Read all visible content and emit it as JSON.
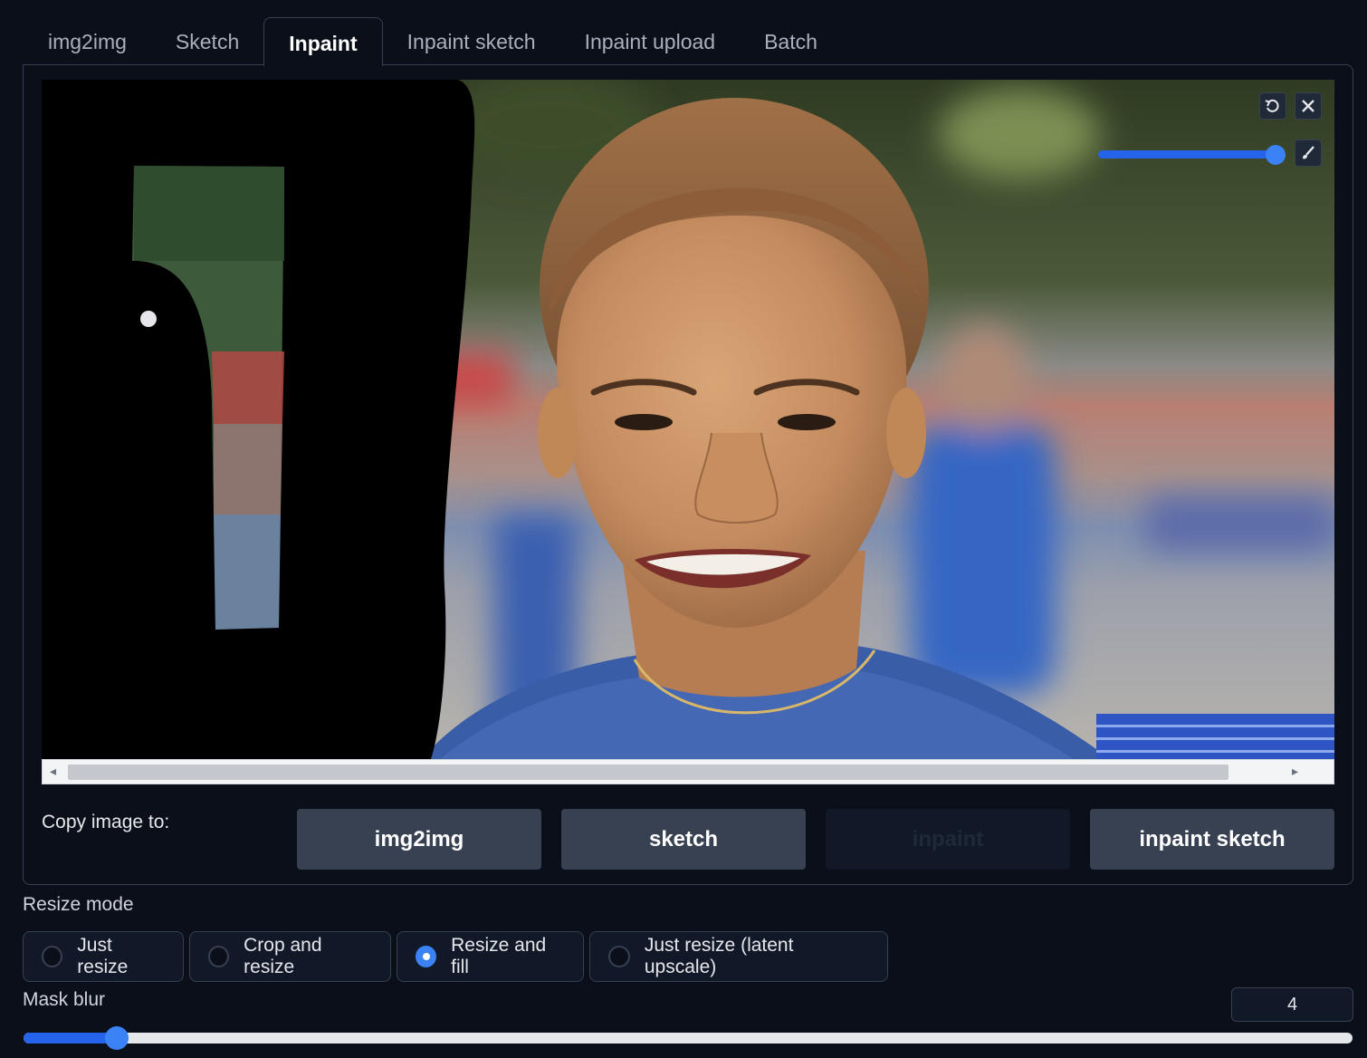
{
  "tabs": [
    {
      "label": "img2img",
      "active": false
    },
    {
      "label": "Sketch",
      "active": false
    },
    {
      "label": "Inpaint",
      "active": true
    },
    {
      "label": "Inpaint sketch",
      "active": false
    },
    {
      "label": "Inpaint upload",
      "active": false
    },
    {
      "label": "Batch",
      "active": false
    }
  ],
  "canvas": {
    "icons": {
      "undo": "undo-icon",
      "clear": "close-icon",
      "brush": "brush-icon"
    },
    "brush_size_level": 0.95
  },
  "copy_image": {
    "label": "Copy image to:",
    "buttons": [
      {
        "label": "img2img",
        "disabled": false
      },
      {
        "label": "sketch",
        "disabled": false
      },
      {
        "label": "inpaint",
        "disabled": true
      },
      {
        "label": "inpaint sketch",
        "disabled": false
      }
    ]
  },
  "resize_mode": {
    "label": "Resize mode",
    "options": [
      "Just resize",
      "Crop and resize",
      "Resize and fill",
      "Just resize (latent upscale)"
    ],
    "selected": "Resize and fill"
  },
  "mask_blur": {
    "label": "Mask blur",
    "value": "4",
    "level": 0.07
  },
  "colors": {
    "accent": "#3b82f6",
    "background": "#0b0f19"
  }
}
